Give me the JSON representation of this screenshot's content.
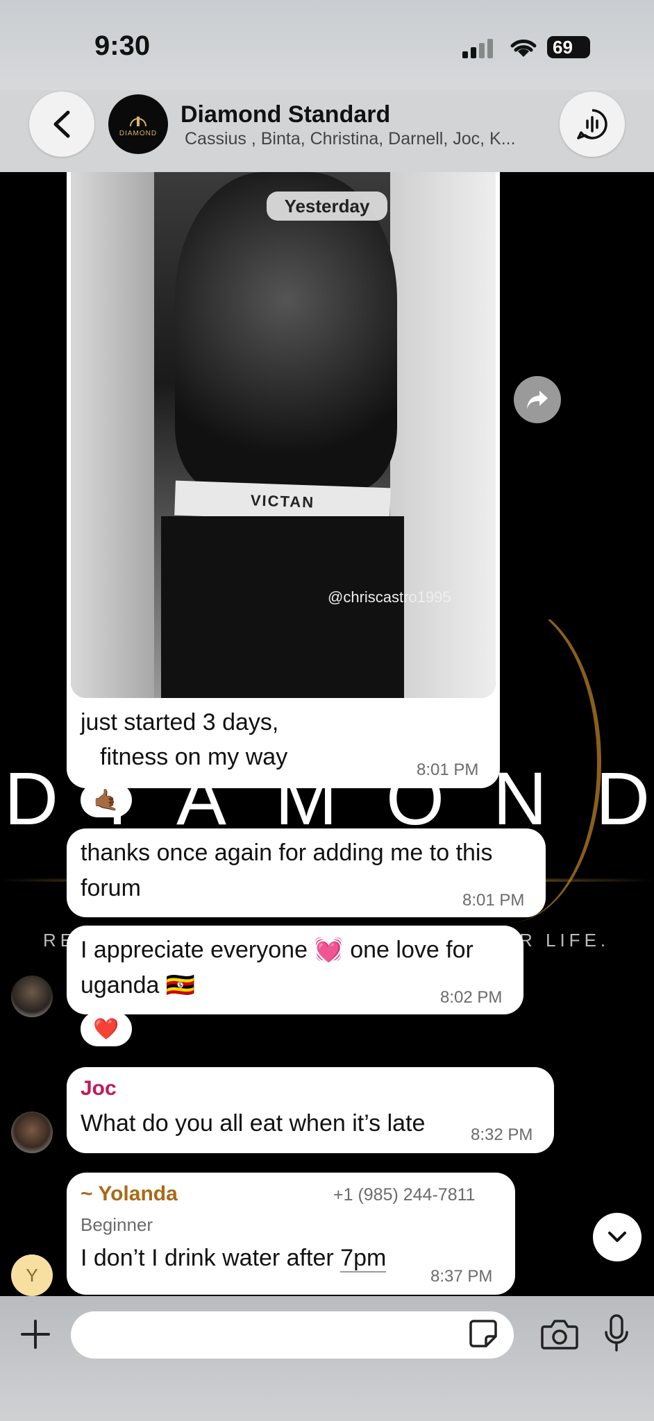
{
  "status_bar": {
    "time": "9:30",
    "battery": "69"
  },
  "header": {
    "title": "Diamond Standard",
    "subtitle": "Cassius , Binta, Christina, Darnell, Joc, K...",
    "avatar_text": "DIAMOND"
  },
  "wallpaper": {
    "word": [
      "D",
      "I",
      "A",
      "M",
      "O",
      "N",
      "D"
    ],
    "tagline_left": "RE",
    "tagline_right": "R LIFE."
  },
  "date_chip": "Yesterday",
  "messages": [
    {
      "text_line1": "just started 3 days,",
      "text_line2": "fitness on my way",
      "time": "8:01 PM",
      "image_watermark": "@chriscastro1995",
      "waistband": "VICTAN",
      "reaction": "🤙🏾"
    },
    {
      "text": "thanks once again for adding me to this forum",
      "time": "8:01 PM"
    },
    {
      "text_line1": "I appreciate everyone 💓 one love for",
      "text_line2": "uganda 🇺🇬",
      "time": "8:02 PM",
      "reaction": "❤️"
    },
    {
      "sender": "Joc",
      "text": "What do you all eat when it’s late",
      "time": "8:32 PM"
    },
    {
      "sender": "~ Yolanda",
      "phone": "+1 (985) 244-7811",
      "role": "Beginner",
      "text_before": "I don’t I drink water after ",
      "text_link": "7pm",
      "time": "8:37 PM",
      "avatar_letter": "Y"
    }
  ],
  "composer": {
    "placeholder": ""
  },
  "colors": {
    "joc": "#c2185b",
    "yolanda": "#a86a17",
    "bubble": "#ffffff"
  }
}
